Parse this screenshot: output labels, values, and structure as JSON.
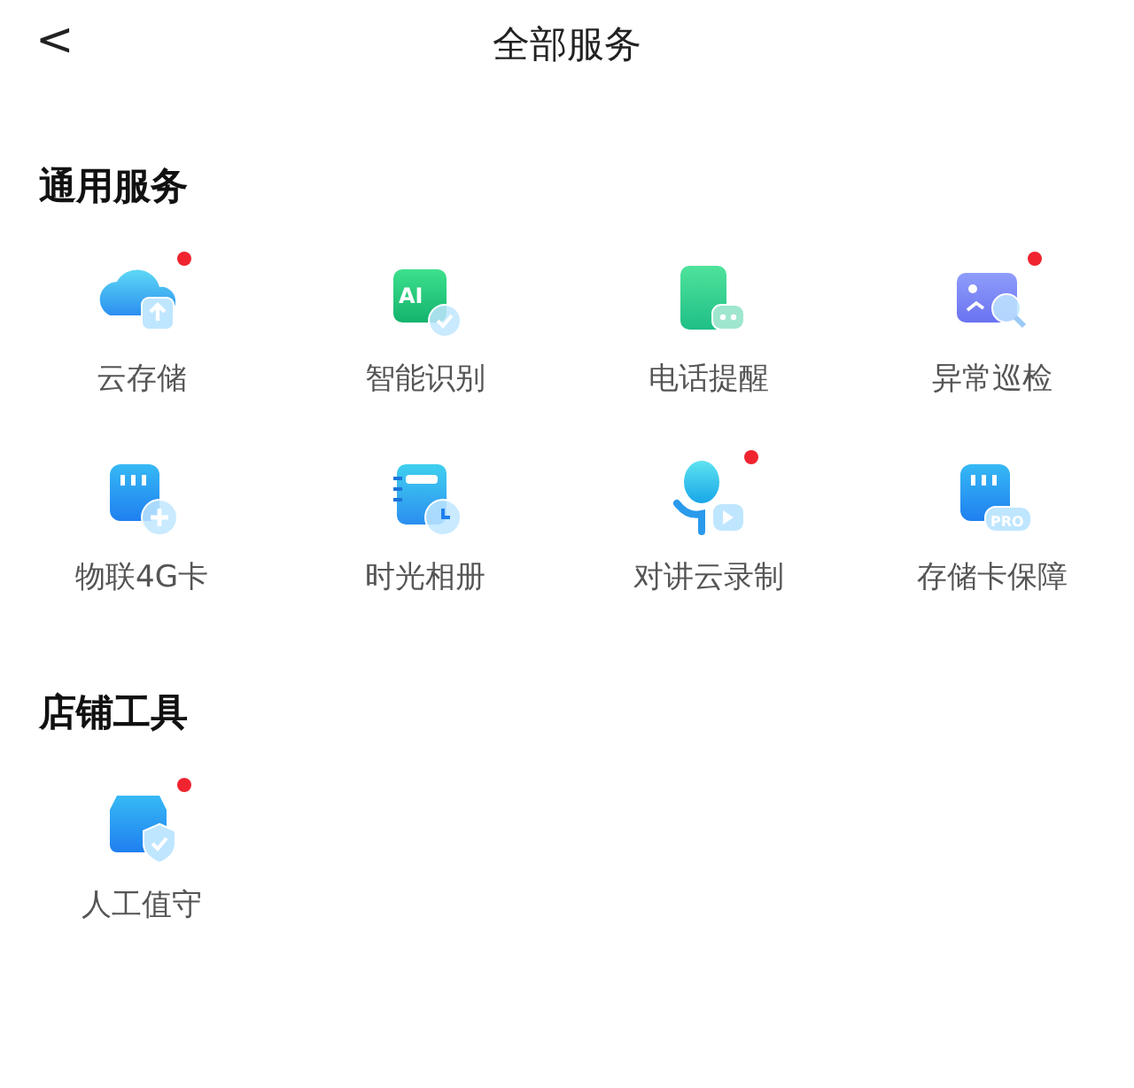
{
  "header": {
    "back": "<",
    "title": "全部服务"
  },
  "sections": [
    {
      "title": "通用服务",
      "items": [
        {
          "label": "云存储",
          "kind": "cloud",
          "dot": true
        },
        {
          "label": "智能识别",
          "kind": "ai",
          "icon_text": "AI",
          "dot": false
        },
        {
          "label": "电话提醒",
          "kind": "phone",
          "dot": false
        },
        {
          "label": "异常巡检",
          "kind": "inspect",
          "dot": true
        },
        {
          "label": "物联4G卡",
          "kind": "sim",
          "dot": false
        },
        {
          "label": "时光相册",
          "kind": "album",
          "dot": false
        },
        {
          "label": "对讲云录制",
          "kind": "mic",
          "dot": true
        },
        {
          "label": "存储卡保障",
          "kind": "sdcard",
          "icon_text": "PRO",
          "dot": false
        }
      ]
    },
    {
      "title": "店铺工具",
      "items": [
        {
          "label": "人工值守",
          "kind": "shop",
          "dot": true
        }
      ]
    }
  ]
}
